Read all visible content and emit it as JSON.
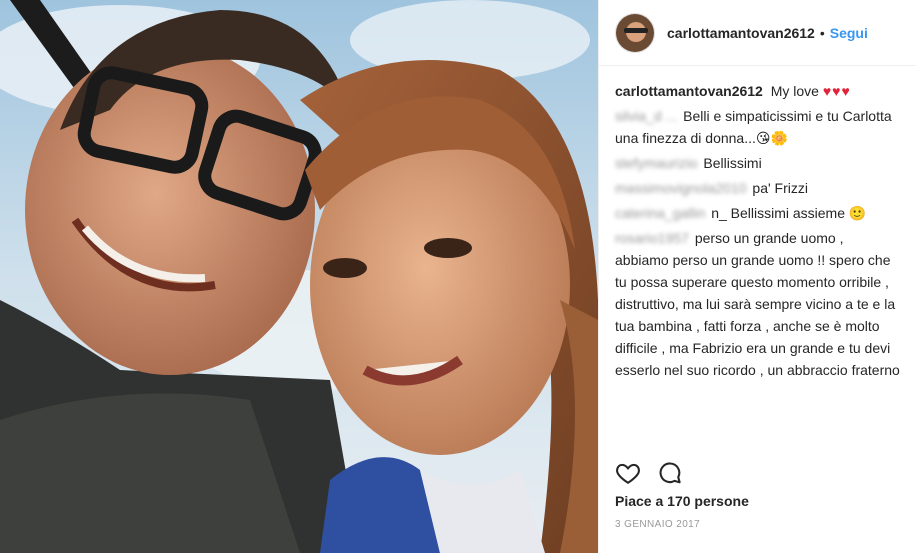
{
  "post": {
    "username": "carlottamantovan2612",
    "separator": "•",
    "follow_label": "Segui",
    "caption": "My love",
    "caption_emoji": "♥♥♥"
  },
  "comments": [
    {
      "user": "silvia_d ...",
      "text": "Belli e simpaticissimi e tu Carlotta una finezza di donna...😘🌼"
    },
    {
      "user": "stefymaurizio",
      "text": "Bellissimi"
    },
    {
      "user": "massimovignola2010",
      "text": "pa' Frizzi"
    },
    {
      "user": "caterina_gallin",
      "text": "n_ Bellissimi assieme 🙂"
    },
    {
      "user": "rosario1957",
      "text": "perso un grande uomo , abbiamo perso un grande uomo !! spero che tu possa superare questo momento orribile , distruttivo, ma lui sarà sempre vicino a te e la tua bambina , fatti forza , anche se è molto difficile , ma Fabrizio era un grande e tu devi esserlo nel suo ricordo , un abbraccio fraterno"
    }
  ],
  "actions": {
    "like_icon": "heart-outline-icon",
    "comment_icon": "comment-bubble-icon"
  },
  "likes_text": "Piace a 170 persone",
  "date_text": "3 GENNAIO 2017",
  "colors": {
    "link": "#3897f0",
    "text": "#262626",
    "muted": "#999999",
    "heart": "#e0243a"
  }
}
